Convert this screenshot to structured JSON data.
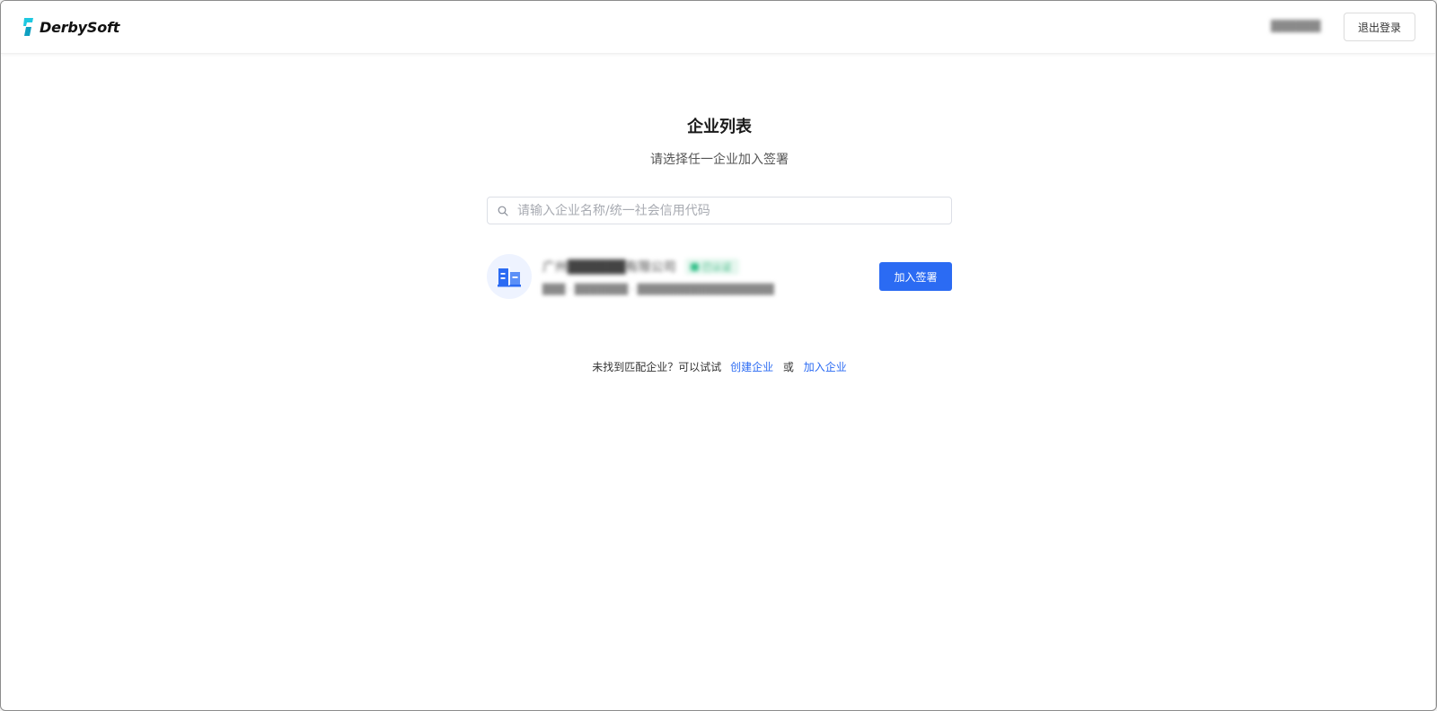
{
  "header": {
    "brand": "DerbySoft",
    "brand_color": "#1ec8e0",
    "user_name": "██████",
    "logout_label": "退出登录"
  },
  "main": {
    "title": "企业列表",
    "subtitle": "请选择任一企业加入签署",
    "search": {
      "placeholder": "请输入企业名称/统一社会信用代码",
      "value": "",
      "icon": "search-icon"
    },
    "companies": [
      {
        "icon": "building-icon",
        "name": "广州██████有限公司",
        "badge": "已认证",
        "meta": "███ · ███████ · ██████████████████",
        "join_label": "加入签署"
      }
    ],
    "footer": {
      "prefix": "未找到匹配企业？可以试试",
      "create_link": "创建企业",
      "or": "或",
      "join_link": "加入企业"
    }
  },
  "colors": {
    "primary": "#2b6bf3",
    "badge_green": "#35c08a",
    "avatar_bg": "#eef3ff"
  }
}
